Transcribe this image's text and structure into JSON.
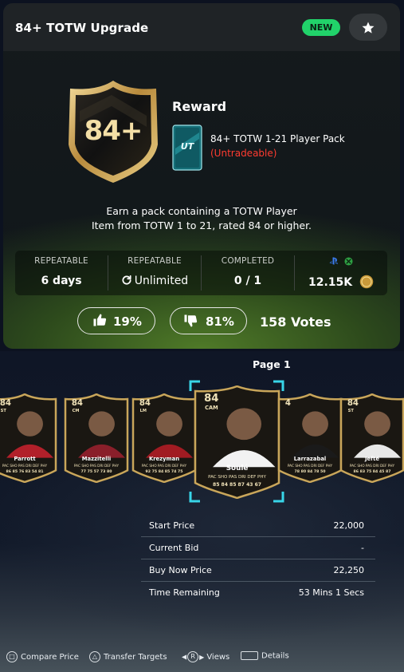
{
  "objective": {
    "title": "84+ TOTW Upgrade",
    "badge": "NEW",
    "favorite_icon": "star-icon",
    "badge_text": "84+",
    "reward_heading": "Reward",
    "pack_logo": "UT",
    "pack_name": "84+ TOTW 1-21 Player Pack",
    "pack_note": "(Untradeable)",
    "description_line1": "Earn a pack containing a TOTW Player",
    "description_line2": "Item from TOTW 1 to 21, rated 84 or higher."
  },
  "stats": [
    {
      "label": "REPEATABLE",
      "value": "6 days"
    },
    {
      "label": "REPEATABLE",
      "value": "Unlimited",
      "icon": "refresh-icon"
    },
    {
      "label": "COMPLETED",
      "value": "0 / 1"
    },
    {
      "label": "",
      "value": "12.15K",
      "icons": [
        "playstation-icon",
        "xbox-icon",
        "ut-coin-icon"
      ]
    }
  ],
  "votes": {
    "like_pct": "19%",
    "dislike_pct": "81%",
    "total": "158 Votes"
  },
  "pager": {
    "label": "Page 1"
  },
  "cards": [
    {
      "name": "Parrott",
      "rating": "84",
      "position": "ST",
      "stats_labels": "PAC SHO PAS DRI DEF PHY",
      "stats": "86 85 76 83 54 81"
    },
    {
      "name": "Mazzitelli",
      "rating": "84",
      "position": "CM",
      "stats_labels": "PAC SHO PAS DRI DEF PHY",
      "stats": "77 75 57 73 80"
    },
    {
      "name": "Krezyman",
      "rating": "84",
      "position": "LM",
      "stats_labels": "PAC SHO PAS DRI DEF PHY",
      "stats": "92 75 84 85 74 75"
    },
    {
      "name": "Soulé",
      "rating": "84",
      "position": "CAM",
      "stats_labels": "PAC SHO PAS DRI DEF PHY",
      "stats": "85 84 85 87 43 67"
    },
    {
      "name": "Larrazabal",
      "rating": "4",
      "position": "",
      "stats_labels": "PAC SHO PAS DRI DEF PHY",
      "stats": "78 80 84 78 50"
    },
    {
      "name": "Jefté",
      "rating": "84",
      "position": "ST",
      "stats_labels": "PAC SHO PAS DRI DEF PHY",
      "stats": "86 83 75 84 45 87"
    }
  ],
  "listing": [
    {
      "label": "Start Price",
      "value": "22,000"
    },
    {
      "label": "Current Bid",
      "value": "-"
    },
    {
      "label": "Buy Now Price",
      "value": "22,250"
    },
    {
      "label": "Time Remaining",
      "value": "53 Mins 1 Secs"
    }
  ],
  "footer": [
    {
      "label": "Compare Price",
      "icon": "square-button-icon"
    },
    {
      "label": "Transfer Targets",
      "icon": "triangle-button-icon"
    },
    {
      "label": "Views",
      "icon": "r-stick-icon"
    },
    {
      "label": "Details",
      "icon": "touchpad-icon"
    }
  ],
  "colors": {
    "new_badge": "#21d26a",
    "untradeable": "#ff3b30",
    "card_gold": "#c9a65a",
    "selected_frame": "#38d5e8"
  }
}
